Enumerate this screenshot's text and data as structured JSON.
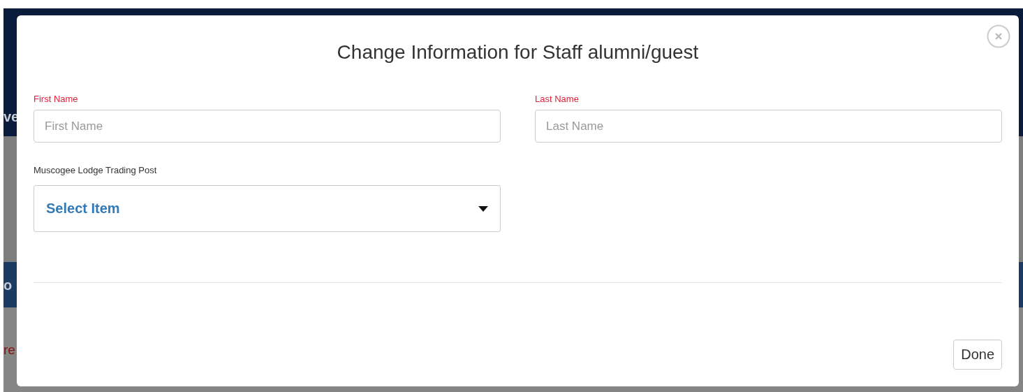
{
  "backdrop": {
    "fragments": [
      {
        "text": "ve",
        "kind": "nav"
      },
      {
        "text": "o",
        "kind": "band"
      },
      {
        "text": "re",
        "kind": "alert"
      }
    ]
  },
  "dialog": {
    "title": "Change Information for Staff alumni/guest",
    "fields": [
      {
        "label": "First Name",
        "placeholder": "First Name",
        "required": true
      },
      {
        "label": "Last Name",
        "placeholder": "Last Name",
        "required": true
      }
    ],
    "select": {
      "label": "Muscogee Lodge Trading Post",
      "value": "Select Item"
    },
    "buttons": [
      "Done"
    ]
  }
}
